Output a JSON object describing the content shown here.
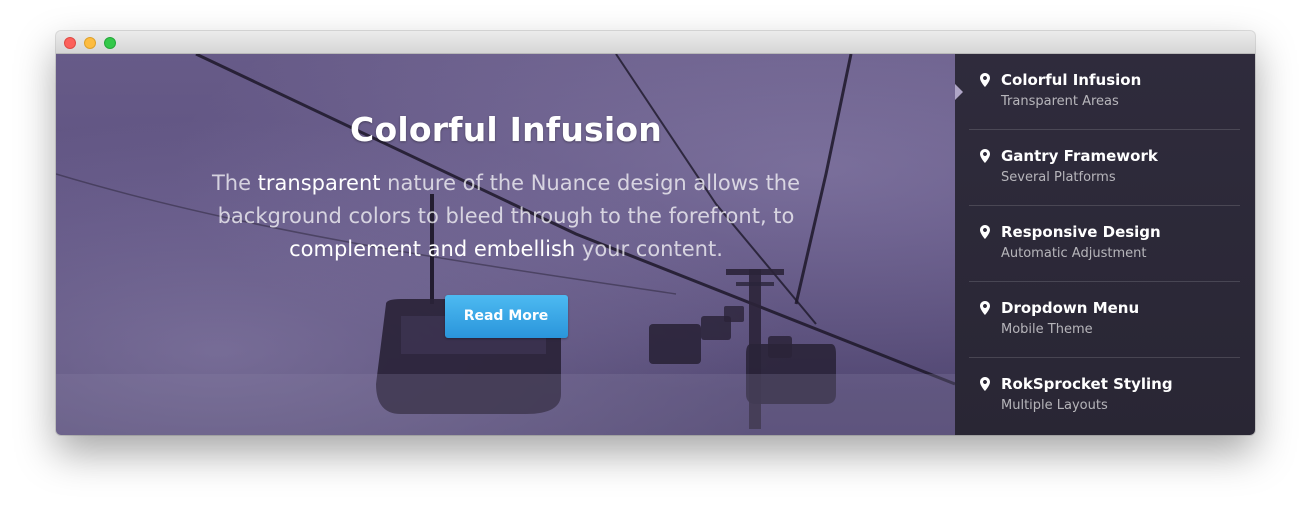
{
  "hero": {
    "title": "Colorful Infusion",
    "description_parts": [
      "The ",
      "transparent",
      " nature of the Nuance design allows the background colors to bleed through to the forefront, to ",
      "complement and embellish",
      " your content."
    ],
    "button_label": "Read More"
  },
  "sidebar": {
    "items": [
      {
        "title": "Colorful Infusion",
        "subtitle": "Transparent Areas",
        "icon": "map-pin-icon"
      },
      {
        "title": "Gantry Framework",
        "subtitle": "Several Platforms",
        "icon": "map-pin-icon"
      },
      {
        "title": "Responsive Design",
        "subtitle": "Automatic Adjustment",
        "icon": "map-pin-icon"
      },
      {
        "title": "Dropdown Menu",
        "subtitle": "Mobile Theme",
        "icon": "map-pin-icon"
      },
      {
        "title": "RokSprocket Styling",
        "subtitle": "Multiple Layouts",
        "icon": "map-pin-icon"
      }
    ]
  },
  "colors": {
    "accent": "#3aa9ea",
    "overlay": "#5d5180",
    "sidebar": "#221e30"
  }
}
